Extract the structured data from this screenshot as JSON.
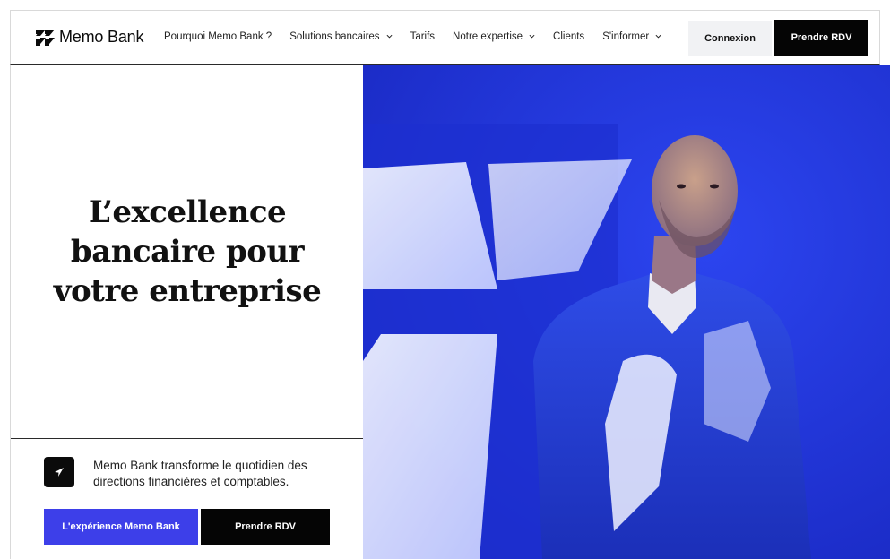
{
  "brand": {
    "name": "Memo Bank",
    "colors": {
      "accent": "#3d3fe9",
      "dark": "#050505",
      "hero_blue": "#2237d8"
    }
  },
  "nav": {
    "items": [
      {
        "label": "Pourquoi Memo Bank ?",
        "has_dropdown": false
      },
      {
        "label": "Solutions bancaires",
        "has_dropdown": true
      },
      {
        "label": "Tarifs",
        "has_dropdown": false
      },
      {
        "label": "Notre expertise",
        "has_dropdown": true
      },
      {
        "label": "Clients",
        "has_dropdown": false
      },
      {
        "label": "S'informer",
        "has_dropdown": true
      }
    ],
    "login_label": "Connexion",
    "cta_label": "Prendre RDV"
  },
  "hero": {
    "headline_lines": [
      "L’excellence",
      "bancaire pour",
      "votre entreprise"
    ],
    "tagline": "Memo Bank transforme le quotidien des directions financières et comptables.",
    "primary_button": "L'expérience Memo Bank",
    "secondary_button": "Prendre RDV",
    "image_icon": "portrait-photo"
  }
}
